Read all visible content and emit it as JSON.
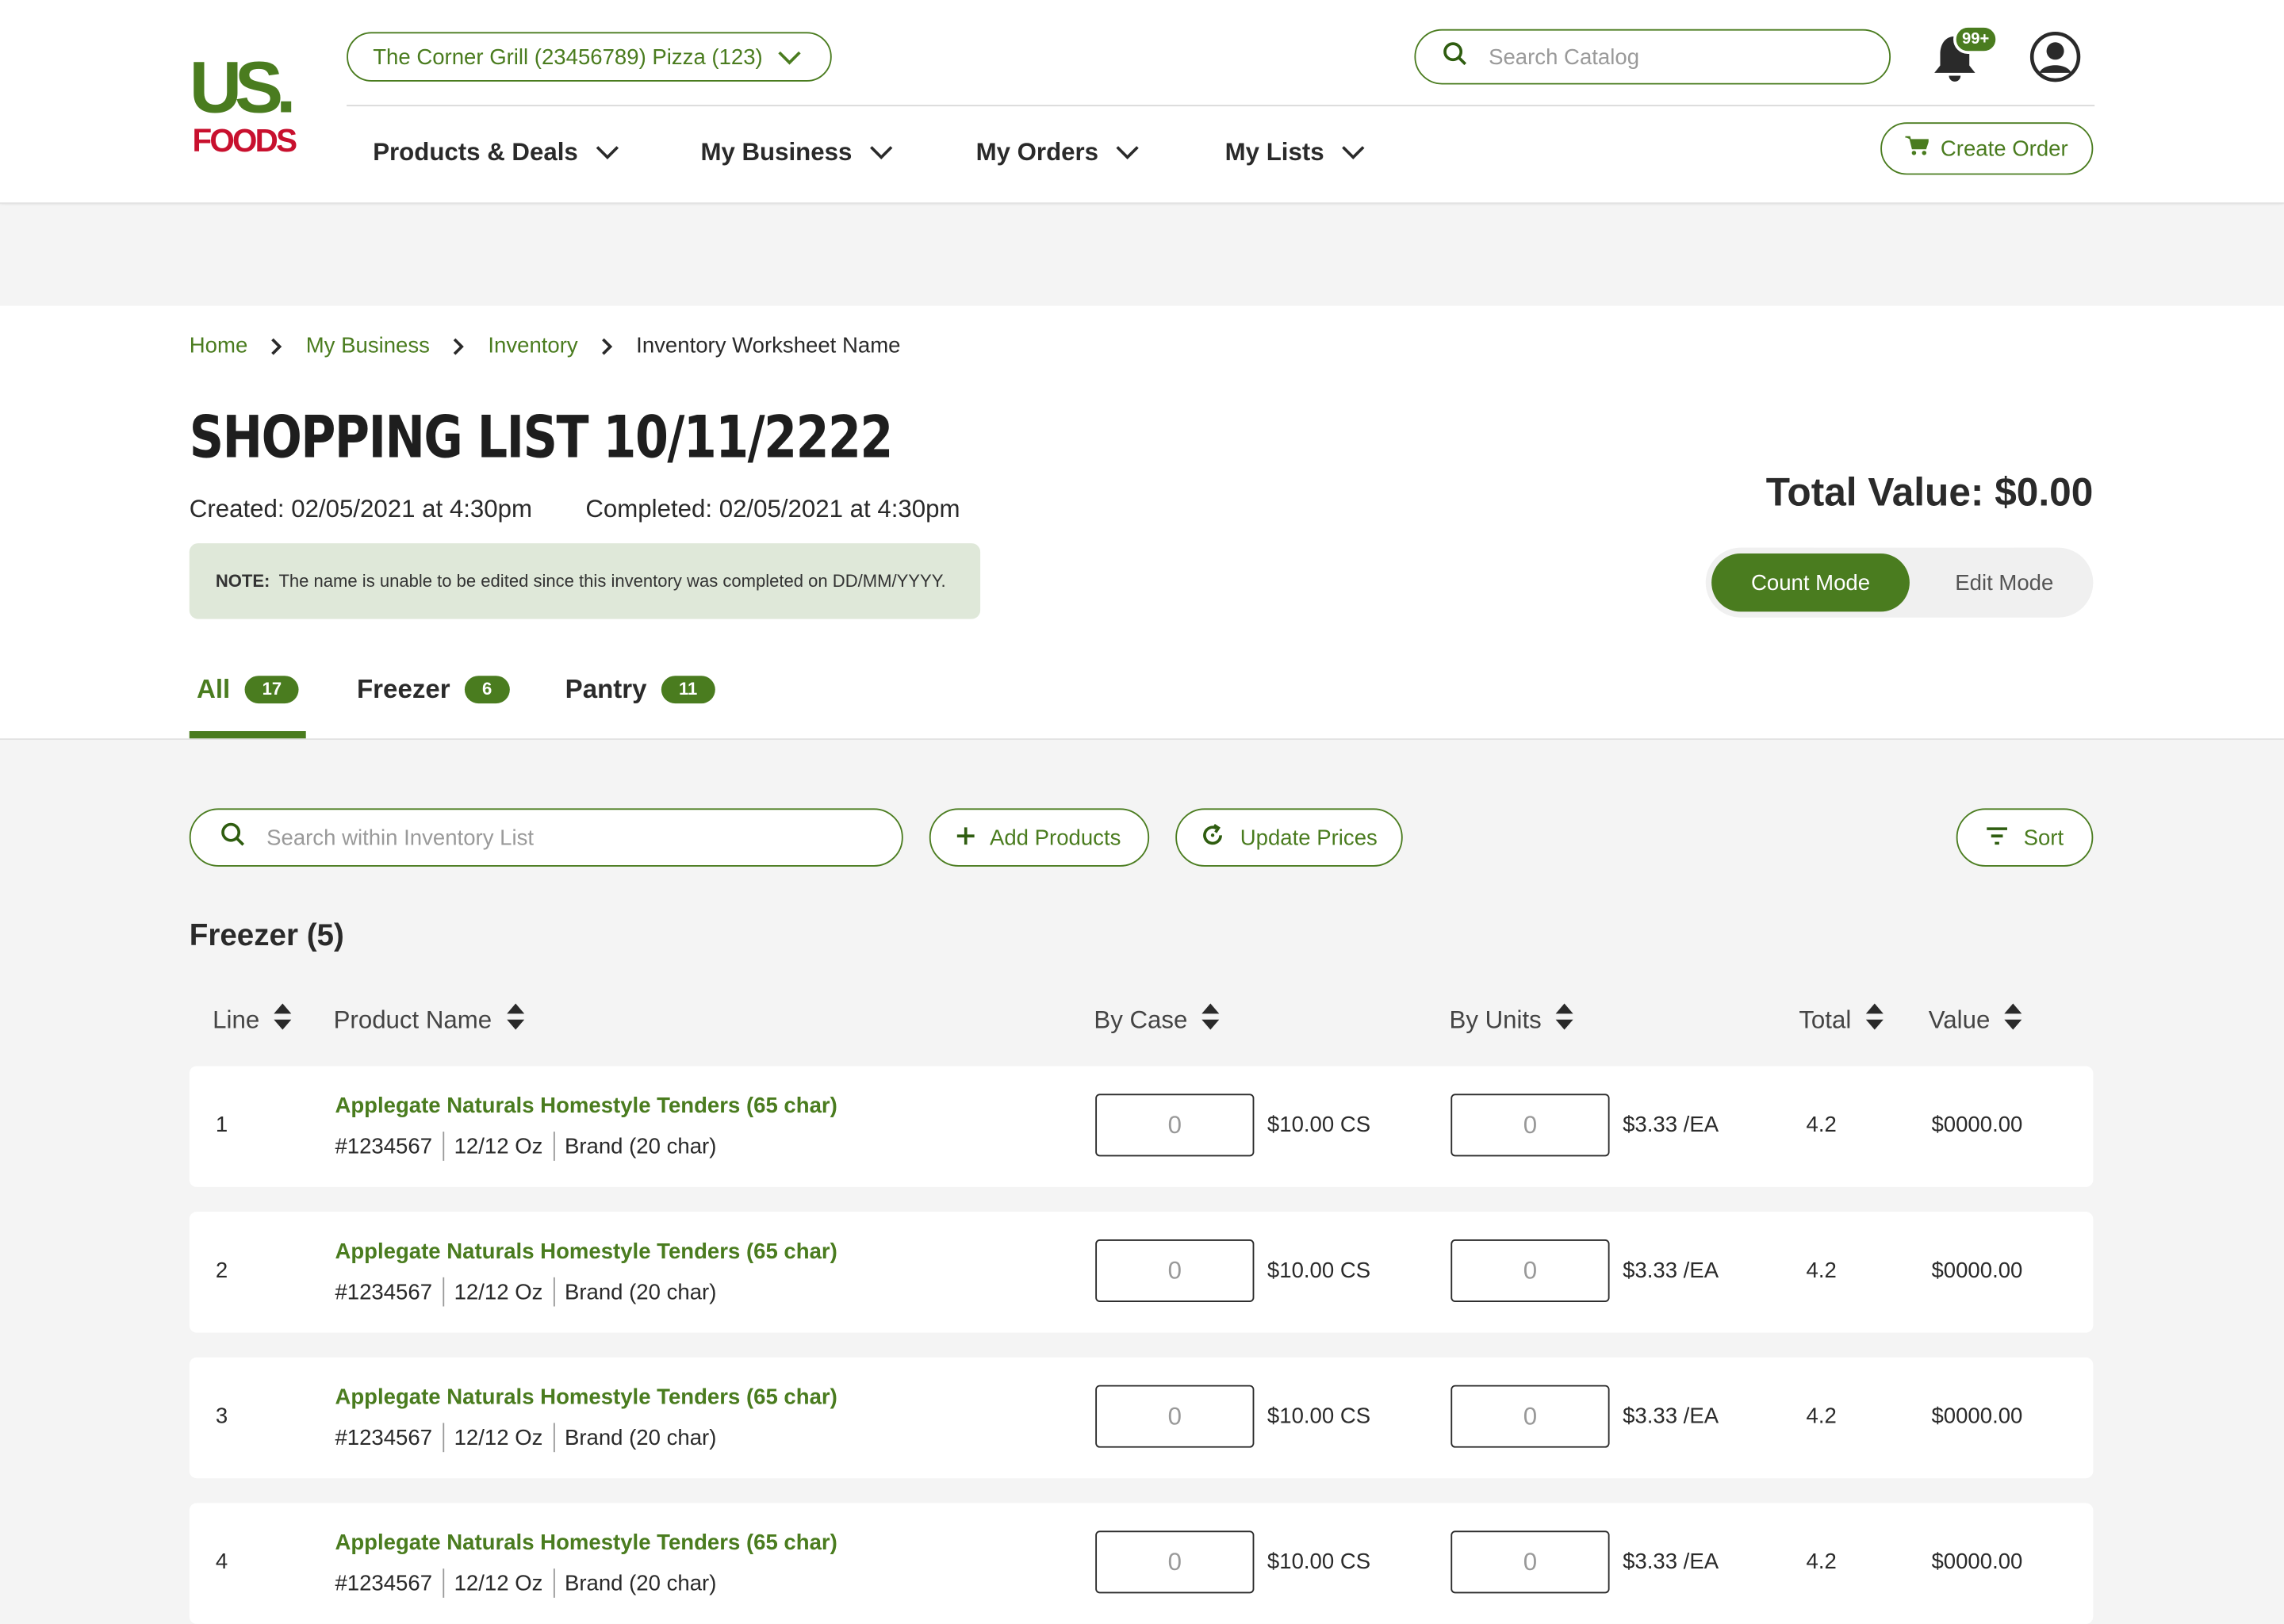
{
  "brand": {
    "logo_text_top": "US.",
    "logo_text_bottom": "FOODS",
    "accent": "#4a7c1f",
    "logo_red": "#c8102e"
  },
  "header": {
    "store_selector": "The Corner Grill (23456789) Pizza (123)",
    "search_placeholder": "Search Catalog",
    "notifications_badge": "99+",
    "nav": [
      "Products & Deals",
      "My Business",
      "My Orders",
      "My Lists"
    ],
    "create_order": "Create Order"
  },
  "breadcrumb": {
    "items": [
      "Home",
      "My Business",
      "Inventory"
    ],
    "current": "Inventory Worksheet Name"
  },
  "page": {
    "title": "SHOPPING LIST 10/11/2222",
    "created": "Created: 02/05/2021 at 4:30pm",
    "completed": "Completed: 02/05/2021 at 4:30pm",
    "note_label": "NOTE:",
    "note_text": "The name is unable to be edited since this inventory was completed on DD/MM/YYYY.",
    "total_value": "Total Value: $0.00",
    "mode_count": "Count Mode",
    "mode_edit": "Edit Mode"
  },
  "tabs": [
    {
      "label": "All",
      "count": "17"
    },
    {
      "label": "Freezer",
      "count": "6"
    },
    {
      "label": "Pantry",
      "count": "11"
    }
  ],
  "toolbar": {
    "search_placeholder": "Search within Inventory List",
    "add_products": "Add Products",
    "update_prices": "Update Prices",
    "sort": "Sort"
  },
  "section": {
    "title": "Freezer (5)"
  },
  "columns": [
    "Line",
    "Product Name",
    "By Case",
    "By Units",
    "Total",
    "Value"
  ],
  "rows": [
    {
      "line": "1",
      "name": "Applegate Naturals Homestyle Tenders (65 char)",
      "sku": "#1234567",
      "pack": "12/12 Oz",
      "brand": "Brand (20 char)",
      "case_qty": "0",
      "case_price": "$10.00 CS",
      "unit_qty": "0",
      "unit_price": "$3.33 /EA",
      "total": "4.2",
      "value": "$0000.00"
    },
    {
      "line": "2",
      "name": "Applegate Naturals Homestyle Tenders (65 char)",
      "sku": "#1234567",
      "pack": "12/12 Oz",
      "brand": "Brand (20 char)",
      "case_qty": "0",
      "case_price": "$10.00 CS",
      "unit_qty": "0",
      "unit_price": "$3.33 /EA",
      "total": "4.2",
      "value": "$0000.00"
    },
    {
      "line": "3",
      "name": "Applegate Naturals Homestyle Tenders (65 char)",
      "sku": "#1234567",
      "pack": "12/12 Oz",
      "brand": "Brand (20 char)",
      "case_qty": "0",
      "case_price": "$10.00 CS",
      "unit_qty": "0",
      "unit_price": "$3.33 /EA",
      "total": "4.2",
      "value": "$0000.00"
    },
    {
      "line": "4",
      "name": "Applegate Naturals Homestyle Tenders (65 char)",
      "sku": "#1234567",
      "pack": "12/12 Oz",
      "brand": "Brand (20 char)",
      "case_qty": "0",
      "case_price": "$10.00 CS",
      "unit_qty": "0",
      "unit_price": "$3.33 /EA",
      "total": "4.2",
      "value": "$0000.00"
    }
  ]
}
